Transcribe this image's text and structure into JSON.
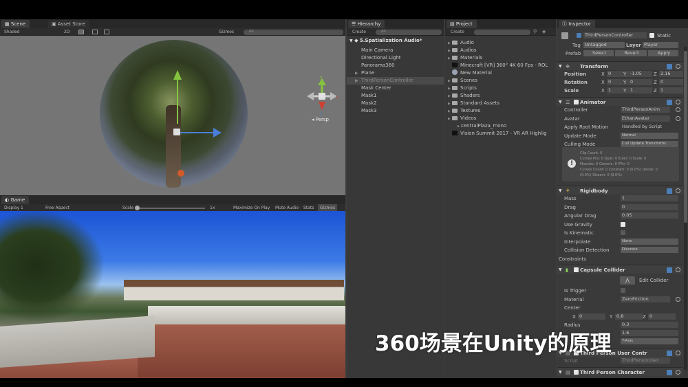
{
  "overlay_caption": "360场景在Unity的原理",
  "scene_panel": {
    "tabs": [
      "Scene",
      "Asset Store"
    ],
    "toolbar": {
      "shading": "Shaded",
      "mode_2d": "2D",
      "gizmos": "Gizmos",
      "search_placeholder": "All"
    },
    "view_label": "Persp",
    "axis_labels": {
      "y": "y",
      "x": "x",
      "z": "z"
    }
  },
  "game_panel": {
    "tab": "Game",
    "toolbar": {
      "display": "Display 1",
      "aspect": "Free Aspect",
      "scale": "Scale",
      "scale_value": "1x",
      "maximize": "Maximize On Play",
      "mute": "Mute Audio",
      "stats": "Stats",
      "gizmos": "Gizmos"
    }
  },
  "hierarchy": {
    "tab": "Hierarchy",
    "create_label": "Create",
    "search_placeholder": "All",
    "scene_name": "5.Spatialization Audio*",
    "items": [
      {
        "label": "Main Camera",
        "indent": 1,
        "arrow": ""
      },
      {
        "label": "Directional Light",
        "indent": 1,
        "arrow": ""
      },
      {
        "label": "Panorama360",
        "indent": 1,
        "arrow": ""
      },
      {
        "label": "Plane",
        "indent": 1,
        "arrow": "▶"
      },
      {
        "label": "ThirdPersonController",
        "indent": 1,
        "arrow": "▶",
        "selected": true
      },
      {
        "label": "Mask Center",
        "indent": 1,
        "arrow": ""
      },
      {
        "label": "Mask1",
        "indent": 1,
        "arrow": ""
      },
      {
        "label": "Mask2",
        "indent": 1,
        "arrow": ""
      },
      {
        "label": "Mask3",
        "indent": 1,
        "arrow": ""
      }
    ]
  },
  "project": {
    "tab": "Project",
    "create_label": "Create",
    "items": [
      {
        "label": "Audio",
        "type": "folder"
      },
      {
        "label": "Audios",
        "type": "folder"
      },
      {
        "label": "Materials",
        "type": "folder"
      },
      {
        "label": "Minecraft [VR] 360° 4K 60 Fps - ROL",
        "type": "file"
      },
      {
        "label": "New Material",
        "type": "material"
      },
      {
        "label": "Scenes",
        "type": "folder"
      },
      {
        "label": "Scripts",
        "type": "folder"
      },
      {
        "label": "Shaders",
        "type": "folder"
      },
      {
        "label": "Standard Assets",
        "type": "folder"
      },
      {
        "label": "Textures",
        "type": "folder"
      },
      {
        "label": "Videos",
        "type": "folder"
      },
      {
        "label": "centralPlaza_mono",
        "type": "video",
        "indent": true
      },
      {
        "label": "Vision Summit 2017 - VR AR Highlig",
        "type": "file"
      }
    ]
  },
  "inspector": {
    "tab": "Inspector",
    "object_name": "ThirdPersonController",
    "static_label": "Static",
    "tag_label": "Tag",
    "tag_value": "Untagged",
    "layer_label": "Layer",
    "layer_value": "Player",
    "prefab_label": "Prefab",
    "prefab_buttons": [
      "Select",
      "Revert",
      "Apply"
    ],
    "transform": {
      "title": "Transform",
      "rows": [
        {
          "label": "Position",
          "x": "0",
          "y": "-1.05",
          "z": "2.16"
        },
        {
          "label": "Rotation",
          "x": "0",
          "y": "0",
          "z": "0"
        },
        {
          "label": "Scale",
          "x": "1",
          "y": "1",
          "z": "1"
        }
      ]
    },
    "animator": {
      "title": "Animator",
      "rows": [
        {
          "label": "Controller",
          "value": "ThirdPersonAnim"
        },
        {
          "label": "Avatar",
          "value": "EthanAvatar"
        },
        {
          "label": "Apply Root Motion",
          "value": "Handled by Script"
        },
        {
          "label": "Update Mode",
          "value": "Normal"
        },
        {
          "label": "Culling Mode",
          "value": "Cull Update Transforms"
        }
      ],
      "info_lines": [
        "Clip Count: 0",
        "Curves Pos: 0 Quat: 0 Euler: 0 Scale: 0",
        "Muscles: 0 Generic: 0 PPtr: 0",
        "Curves Count: 0 Constant: 0 (0.0%) Dense: 0",
        "(0.0%) Stream: 0 (0.0%)"
      ]
    },
    "rigidbody": {
      "title": "Rigidbody",
      "rows": [
        {
          "label": "Mass",
          "value": "1"
        },
        {
          "label": "Drag",
          "value": "0"
        },
        {
          "label": "Angular Drag",
          "value": "0.05"
        },
        {
          "label": "Use Gravity",
          "value": ""
        },
        {
          "label": "Is Kinematic",
          "value": ""
        },
        {
          "label": "Interpolate",
          "value": "None"
        },
        {
          "label": "Collision Detection",
          "value": "Discrete"
        },
        {
          "label": "Constraints",
          "value": ""
        }
      ]
    },
    "capsule_collider": {
      "title": "Capsule Collider",
      "edit_label": "Edit Collider",
      "rows": [
        {
          "label": "Is Trigger",
          "value": ""
        },
        {
          "label": "Material",
          "value": "ZeroFriction"
        },
        {
          "label": "Center",
          "value": ""
        }
      ],
      "center": {
        "x": "0",
        "y": "0.8",
        "z": "0"
      },
      "radius_label": "Radius",
      "radius_value": "0.3",
      "height_value": "1.6",
      "direction_value": "Y-Axis"
    },
    "user_control": {
      "title": "Third Person User Contr",
      "script_label": "Script",
      "script_value": "ThirdPersonUser"
    },
    "character": {
      "title": "Third Person Character"
    }
  }
}
